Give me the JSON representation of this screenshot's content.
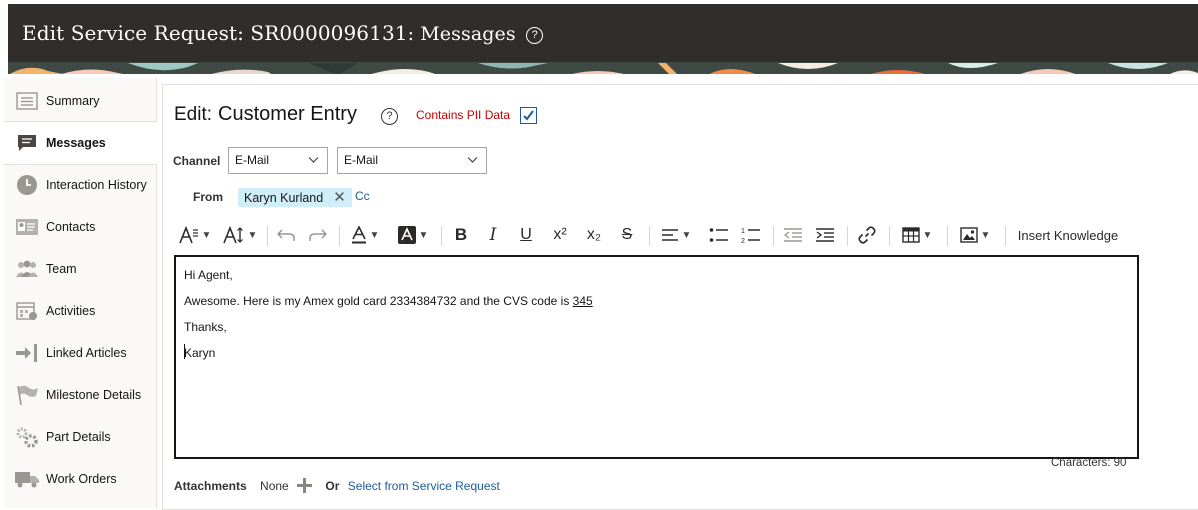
{
  "header": {
    "title": "Edit Service Request: SR0000096131",
    "subtitle": ": Messages",
    "help_glyph": "?"
  },
  "sidebar": {
    "items": [
      {
        "label": "Summary",
        "icon": "summary-icon"
      },
      {
        "label": "Messages",
        "icon": "messages-icon",
        "active": true
      },
      {
        "label": "Interaction History",
        "icon": "clock-icon"
      },
      {
        "label": "Contacts",
        "icon": "contacts-icon"
      },
      {
        "label": "Team",
        "icon": "team-icon"
      },
      {
        "label": "Activities",
        "icon": "calendar-icon"
      },
      {
        "label": "Linked Articles",
        "icon": "link-arrow-icon"
      },
      {
        "label": "Milestone Details",
        "icon": "flag-icon"
      },
      {
        "label": "Part Details",
        "icon": "gears-icon"
      },
      {
        "label": "Work Orders",
        "icon": "truck-icon"
      }
    ]
  },
  "editor_panel": {
    "edit_label": "Edit:",
    "entry_name": "Customer Entry",
    "help_glyph": "?",
    "pii_label": "Contains PII Data",
    "pii_checked": true,
    "channel_label": "Channel",
    "channel_select_1": "E-Mail",
    "channel_select_2": "E-Mail",
    "from_label": "From",
    "from_recipient": "Karyn Kurland",
    "cc_label": "Cc",
    "toolbar": {
      "insert_knowledge": "Insert Knowledge"
    },
    "body": {
      "line1": "Hi Agent,",
      "line2": "Awesome. Here is my Amex gold card 2334384732 and the CVS code is ",
      "line2_link": "345",
      "line3": "Thanks,",
      "line4": "Karyn"
    },
    "char_count": "Characters: 90",
    "attachments_label": "Attachments",
    "attachments_value": "None",
    "or_label": "Or",
    "select_link": "Select from Service Request"
  },
  "colors": {
    "header_bg": "#312d2a",
    "link": "#1c5b9d",
    "pii_red": "#cc0000",
    "chip_bg": "#cfeef9"
  }
}
